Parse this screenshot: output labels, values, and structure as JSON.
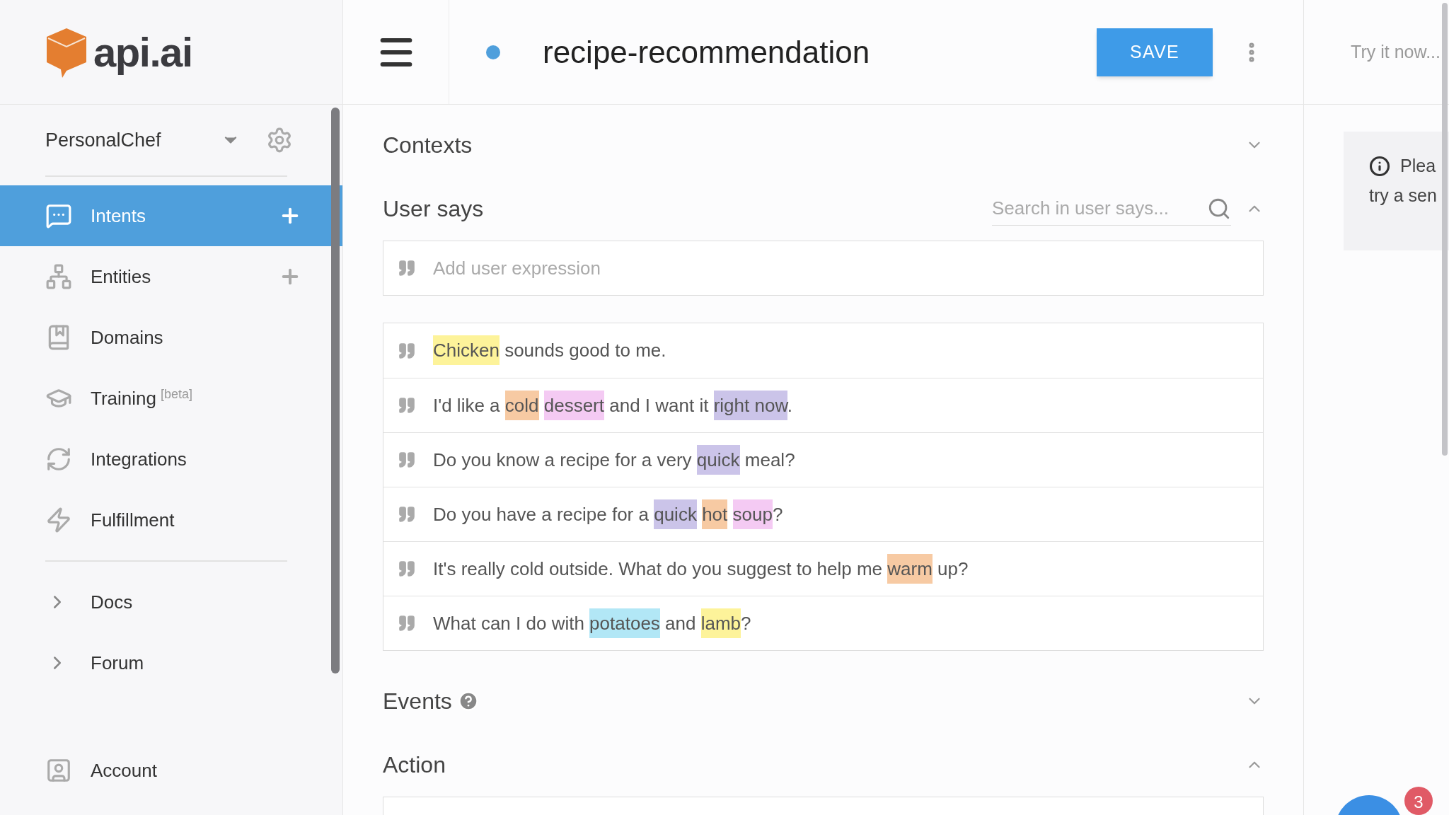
{
  "logo": {
    "text": "api.ai"
  },
  "agent": {
    "name": "PersonalChef"
  },
  "sidebar": {
    "items": [
      {
        "label": "Intents",
        "kind": "nav",
        "selected": true,
        "addable": true
      },
      {
        "label": "Entities",
        "kind": "nav",
        "selected": false,
        "addable": true
      },
      {
        "label": "Domains",
        "kind": "nav",
        "selected": false,
        "addable": false
      },
      {
        "label": "Training",
        "badge": "[beta]",
        "kind": "nav",
        "selected": false,
        "addable": false
      },
      {
        "label": "Integrations",
        "kind": "nav",
        "selected": false,
        "addable": false
      },
      {
        "label": "Fulfillment",
        "kind": "nav",
        "selected": false,
        "addable": false
      },
      {
        "label": "Docs",
        "kind": "link",
        "selected": false
      },
      {
        "label": "Forum",
        "kind": "link",
        "selected": false
      }
    ],
    "account": "Account"
  },
  "header": {
    "title": "recipe-recommendation",
    "save": "SAVE"
  },
  "sections": [
    {
      "title": "Contexts",
      "expanded": false,
      "help": false
    },
    {
      "title": "User says",
      "expanded": true,
      "help": false,
      "search_placeholder": "Search in user says...",
      "add_placeholder": "Add user expression",
      "expressions": [
        {
          "segments": [
            {
              "text": "Chicken",
              "color": "#fdf39a"
            },
            {
              "text": " sounds good to me."
            }
          ]
        },
        {
          "segments": [
            {
              "text": "I'd like a "
            },
            {
              "text": "cold",
              "color": "#f7caa3"
            },
            {
              "text": "dessert",
              "color": "#f4caf3",
              "gap_before": true
            },
            {
              "text": " and I want it "
            },
            {
              "text": "right now",
              "color": "#cbc4e9"
            },
            {
              "text": "."
            }
          ]
        },
        {
          "segments": [
            {
              "text": "Do you know a recipe for a very "
            },
            {
              "text": "quick",
              "color": "#cbc4e9"
            },
            {
              "text": " meal?"
            }
          ]
        },
        {
          "segments": [
            {
              "text": "Do you have a recipe for a "
            },
            {
              "text": "quick",
              "color": "#cbc4e9"
            },
            {
              "text": "hot",
              "color": "#f7caa3",
              "gap_before": true
            },
            {
              "text": "soup",
              "color": "#f4caf3",
              "gap_before": true
            },
            {
              "text": "?"
            }
          ]
        },
        {
          "segments": [
            {
              "text": "It's really cold outside. What do you suggest to help me "
            },
            {
              "text": "warm",
              "color": "#f7caa3"
            },
            {
              "text": " up?"
            }
          ]
        },
        {
          "segments": [
            {
              "text": "What can I do with "
            },
            {
              "text": "potatoes",
              "color": "#b2e7f6"
            },
            {
              "text": " and "
            },
            {
              "text": "lamb",
              "color": "#fdf39a"
            },
            {
              "text": "?"
            }
          ]
        }
      ]
    },
    {
      "title": "Events",
      "expanded": false,
      "help": true
    },
    {
      "title": "Action",
      "expanded": true,
      "help": false
    }
  ],
  "try_panel": {
    "placeholder": "Try it now...",
    "info_lines": [
      "Plea",
      "try a sen"
    ]
  },
  "chat": {
    "badge": "3"
  }
}
